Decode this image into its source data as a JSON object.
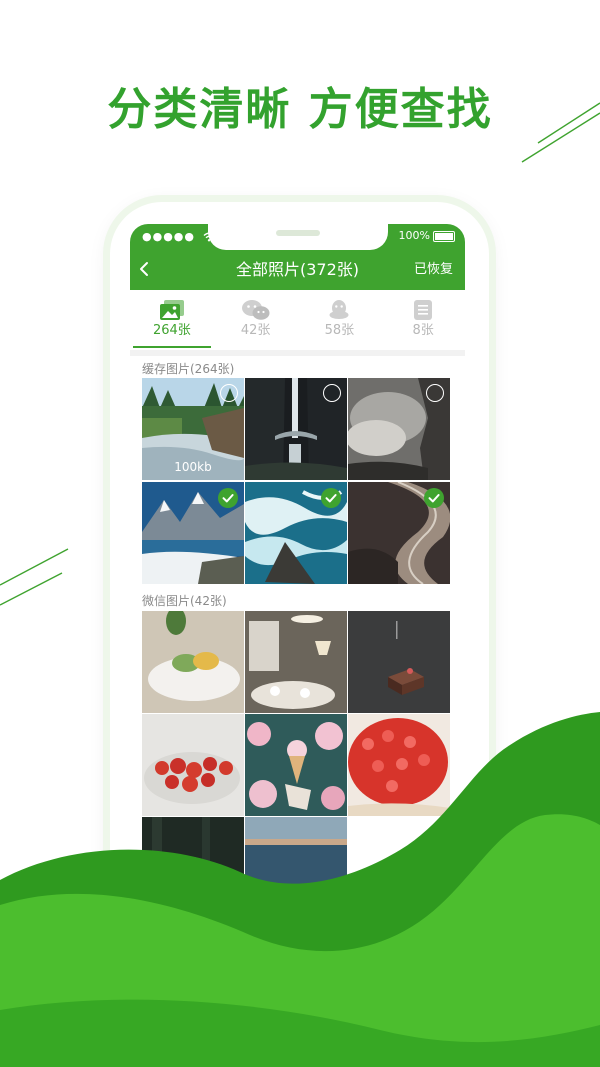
{
  "headline": "分类清晰 方便查找",
  "status": {
    "signal_text": "●●●●●",
    "battery_text": "100%"
  },
  "nav": {
    "title": "全部照片(372张)",
    "right_action": "已恢复"
  },
  "tabs": [
    {
      "label": "264张",
      "icon": "gallery-icon",
      "active": true
    },
    {
      "label": "42张",
      "icon": "wechat-icon",
      "active": false
    },
    {
      "label": "58张",
      "icon": "qq-icon",
      "active": false
    },
    {
      "label": "8张",
      "icon": "document-icon",
      "active": false
    }
  ],
  "sections": {
    "cache": {
      "title": "缓存图片(264张)",
      "photos": [
        {
          "subject": "forest-river",
          "size_label": "100kb",
          "selected": false
        },
        {
          "subject": "waterfall-bridge",
          "size_label": "",
          "selected": false
        },
        {
          "subject": "storm-cliff",
          "size_label": "",
          "selected": false
        },
        {
          "subject": "mountain-lake",
          "size_label": "",
          "selected": true
        },
        {
          "subject": "ocean-waves",
          "size_label": "",
          "selected": true
        },
        {
          "subject": "railway-curve",
          "size_label": "",
          "selected": true
        }
      ]
    },
    "wechat": {
      "title": "微信图片(42张)",
      "photos": [
        {
          "subject": "macarons-plate"
        },
        {
          "subject": "cafe-table"
        },
        {
          "subject": "dark-cake"
        },
        {
          "subject": "strawberries-dish"
        },
        {
          "subject": "ice-cream-flowers"
        },
        {
          "subject": "strawberry-tart"
        },
        {
          "subject": "dark-forest"
        },
        {
          "subject": "sea-sunset"
        }
      ]
    }
  },
  "colors": {
    "brand_green": "#3fa32f",
    "headline_green": "#33a22e",
    "wave_light": "#4cbe2e",
    "wave_dark": "#2f9a1f"
  }
}
